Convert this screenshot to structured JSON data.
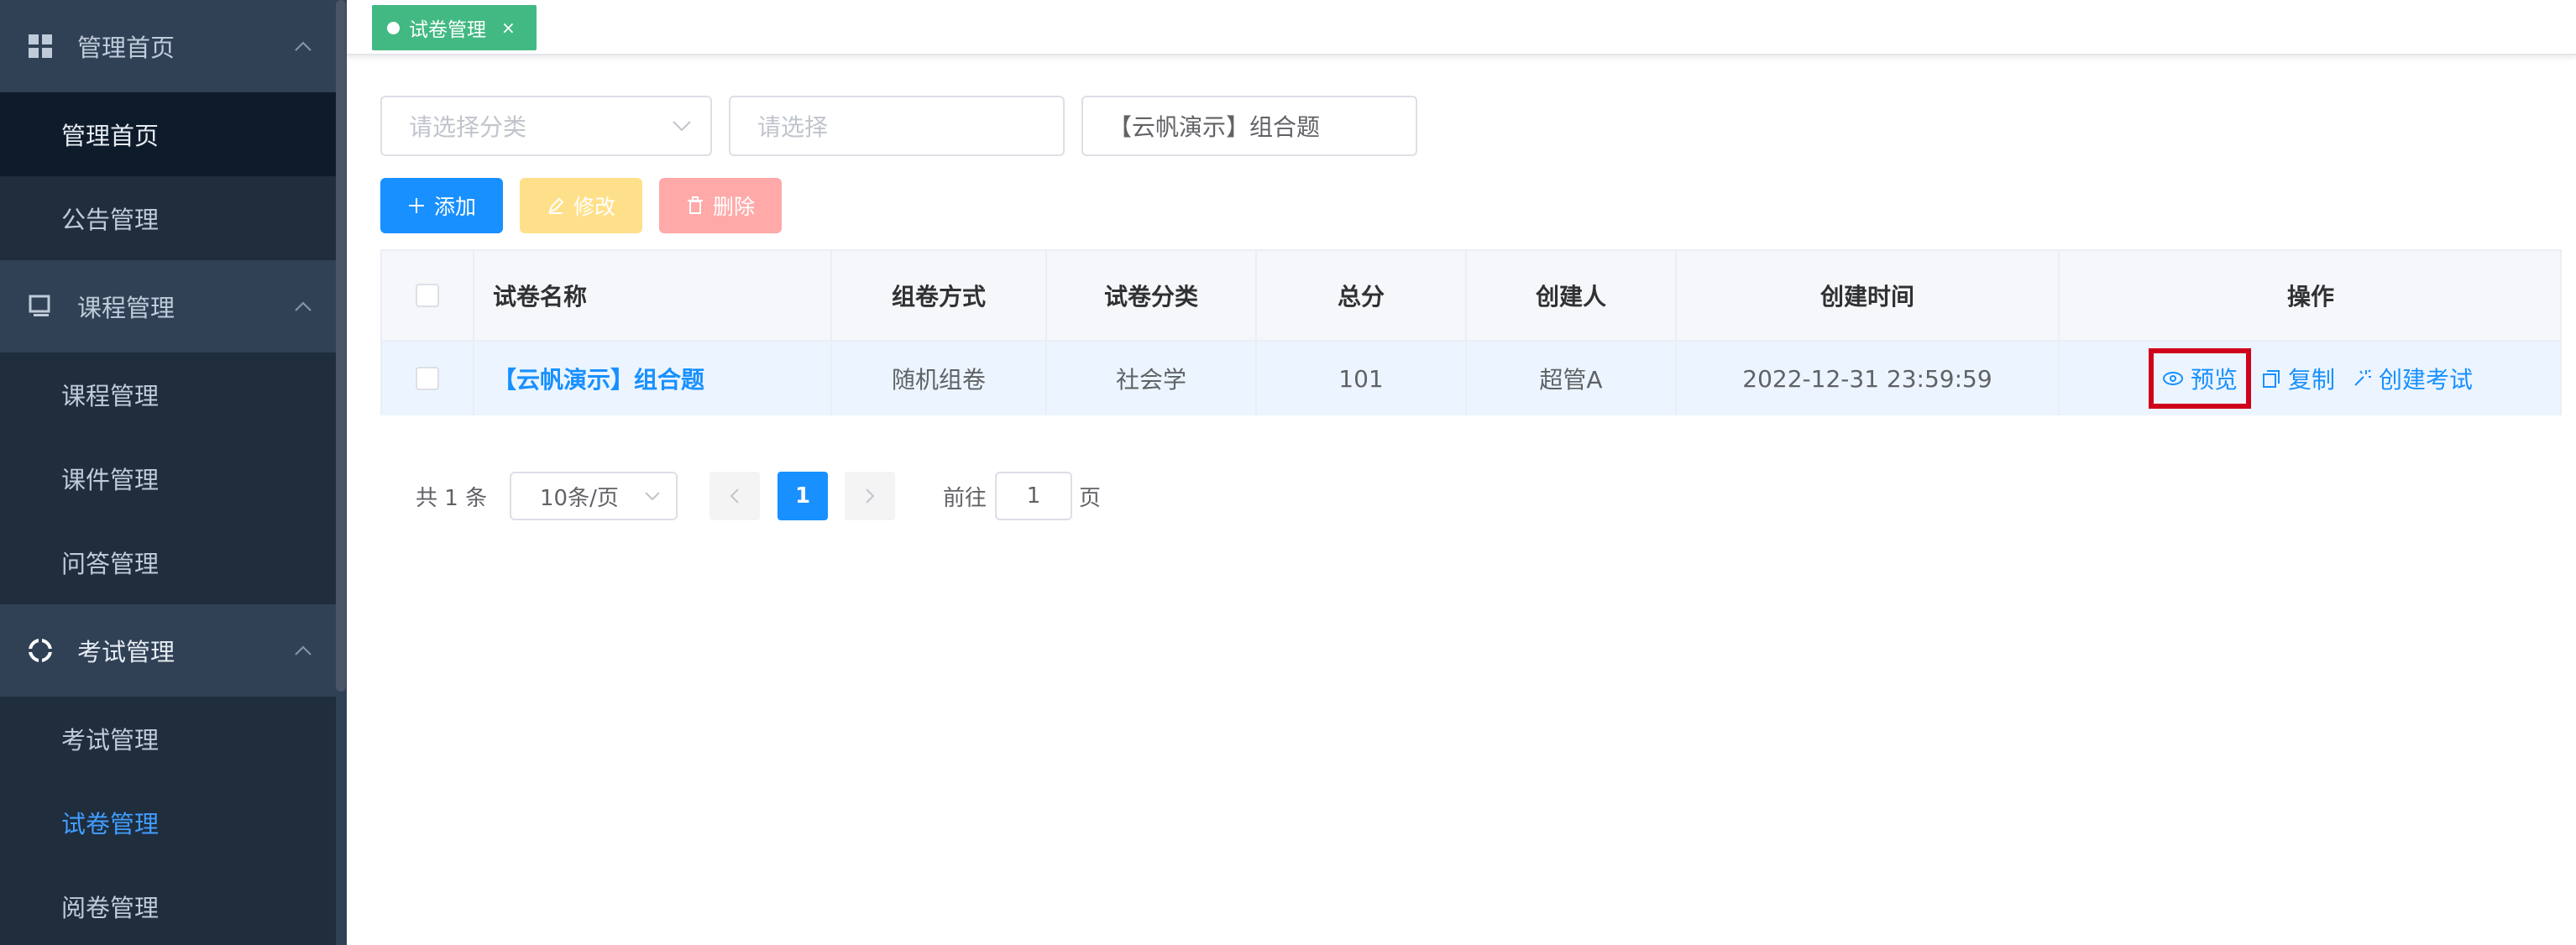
{
  "sidebar": {
    "groups": [
      {
        "label": "管理首页",
        "icon": "dashboard-grid-icon"
      },
      {
        "label": "课程管理",
        "icon": "monitor-icon"
      },
      {
        "label": "考试管理",
        "icon": "lifebuoy-icon"
      }
    ],
    "items": [
      {
        "label": "管理首页"
      },
      {
        "label": "公告管理"
      },
      {
        "label": "课程管理"
      },
      {
        "label": "课件管理"
      },
      {
        "label": "问答管理"
      },
      {
        "label": "考试管理"
      },
      {
        "label": "试卷管理"
      },
      {
        "label": "阅卷管理"
      }
    ]
  },
  "tabs": [
    {
      "label": "试卷管理",
      "close": "×"
    }
  ],
  "filters": {
    "category_placeholder": "请选择分类",
    "select_placeholder": "请选择",
    "keyword_value": "【云帆演示】组合题"
  },
  "toolbar": {
    "add_label": "添加",
    "edit_label": "修改",
    "delete_label": "删除"
  },
  "table": {
    "headers": [
      "试卷名称",
      "组卷方式",
      "试卷分类",
      "总分",
      "创建人",
      "创建时间",
      "操作"
    ],
    "rows": [
      {
        "name": "【云帆演示】组合题",
        "mode": "随机组卷",
        "category": "社会学",
        "score": "101",
        "creator": "超管A",
        "created": "2022-12-31 23:59:59"
      }
    ],
    "actions": {
      "preview": "预览",
      "copy": "复制",
      "create_exam": "创建考试"
    }
  },
  "pagination": {
    "total_text": "共 1 条",
    "page_size": "10条/页",
    "current_page": "1",
    "goto_prefix": "前往",
    "goto_value": "1",
    "goto_suffix": "页"
  },
  "colors": {
    "sidebar_bg": "#304156",
    "accent": "#1890ff",
    "tag_green": "#42b983",
    "highlight_red": "#d0021b"
  }
}
